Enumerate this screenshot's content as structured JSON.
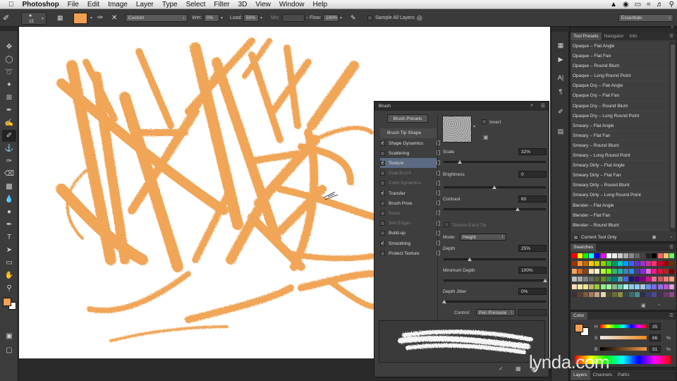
{
  "menubar": {
    "apple": "",
    "app": "Photoshop",
    "items": [
      "File",
      "Edit",
      "Image",
      "Layer",
      "Type",
      "Select",
      "Filter",
      "3D",
      "View",
      "Window",
      "Help"
    ]
  },
  "options": {
    "brush_size": "15",
    "mode_value": "Custom",
    "wet_label": "Wet:",
    "wet_value": "0%",
    "load_label": "Load:",
    "load_value": "50%",
    "mix_label": "Mix:",
    "mix_value": "",
    "flow_label": "Flow:",
    "flow_value": "100%",
    "sample_all_layers": "Sample All Layers",
    "workspace": "Essentials",
    "fg_color": "#f2a052"
  },
  "tool_presets": {
    "tabs": [
      "Tool Presets",
      "Navigator",
      "Info"
    ],
    "items": [
      "Opaque – Flat Angle",
      "Opaque – Flat Fan",
      "Opaque – Round Blunt",
      "Opaque – Long Round Point",
      "Opaque Dry – Flat Angle",
      "Opaque Dry – Flat Fan",
      "Opaque Dry – Round Blunt",
      "Opaque Dry – Long Round Point",
      "Smeary – Flat Angle",
      "Smeary – Flat Fan",
      "Smeary – Round Blunt",
      "Smeary – Long Round Point",
      "Smeary Dirty – Flat Angle",
      "Smeary Dirty – Flat Fan",
      "Smeary Dirty – Round Blunt",
      "Smeary Dirty – Long Round Point",
      "Blender – Flat Angle",
      "Blender – Flat Fan",
      "Blender – Round Blunt"
    ],
    "current_tool_only": "Current Tool Only"
  },
  "swatches": {
    "tab": "Swatches"
  },
  "color": {
    "tab": "Color",
    "h_label": "H",
    "h_value": "35",
    "s_label": "S",
    "s_value": "86",
    "b_label": "B",
    "b_value": "91",
    "pct": "%"
  },
  "layers_tabs": [
    "Layers",
    "Channels",
    "Paths"
  ],
  "brush_panel": {
    "title": "Brush",
    "presets_button": "Brush Presets",
    "tip_shape": "Brush Tip Shape",
    "options": [
      {
        "label": "Shape Dynamics",
        "checked": true,
        "dim": false,
        "sel": false
      },
      {
        "label": "Scattering",
        "checked": false,
        "dim": false,
        "sel": false
      },
      {
        "label": "Texture",
        "checked": true,
        "dim": false,
        "sel": true
      },
      {
        "label": "Dual Brush",
        "checked": false,
        "dim": true,
        "sel": false
      },
      {
        "label": "Color Dynamics",
        "checked": false,
        "dim": true,
        "sel": false
      },
      {
        "label": "Transfer",
        "checked": true,
        "dim": false,
        "sel": false
      },
      {
        "label": "Brush Pose",
        "checked": false,
        "dim": false,
        "sel": false
      },
      {
        "label": "Noise",
        "checked": false,
        "dim": true,
        "sel": false
      },
      {
        "label": "Wet Edges",
        "checked": false,
        "dim": true,
        "sel": false
      },
      {
        "label": "Build-up",
        "checked": false,
        "dim": false,
        "sel": false
      },
      {
        "label": "Smoothing",
        "checked": true,
        "dim": false,
        "sel": false
      },
      {
        "label": "Protect Texture",
        "checked": false,
        "dim": false,
        "sel": false
      }
    ],
    "invert": "Invert",
    "scale_label": "Scale",
    "scale_value": "32%",
    "brightness_label": "Brightness",
    "brightness_value": "0",
    "contrast_label": "Contrast",
    "contrast_value": "60",
    "texture_each_tip": "Texture Each Tip",
    "mode_label": "Mode:",
    "mode_value": "Height",
    "depth_label": "Depth",
    "depth_value": "25%",
    "min_depth_label": "Minimum Depth",
    "min_depth_value": "100%",
    "depth_jitter_label": "Depth Jitter",
    "depth_jitter_value": "0%",
    "control_label": "Control:",
    "control_value": "Pen Pressure"
  },
  "watermark": "lynda.com"
}
